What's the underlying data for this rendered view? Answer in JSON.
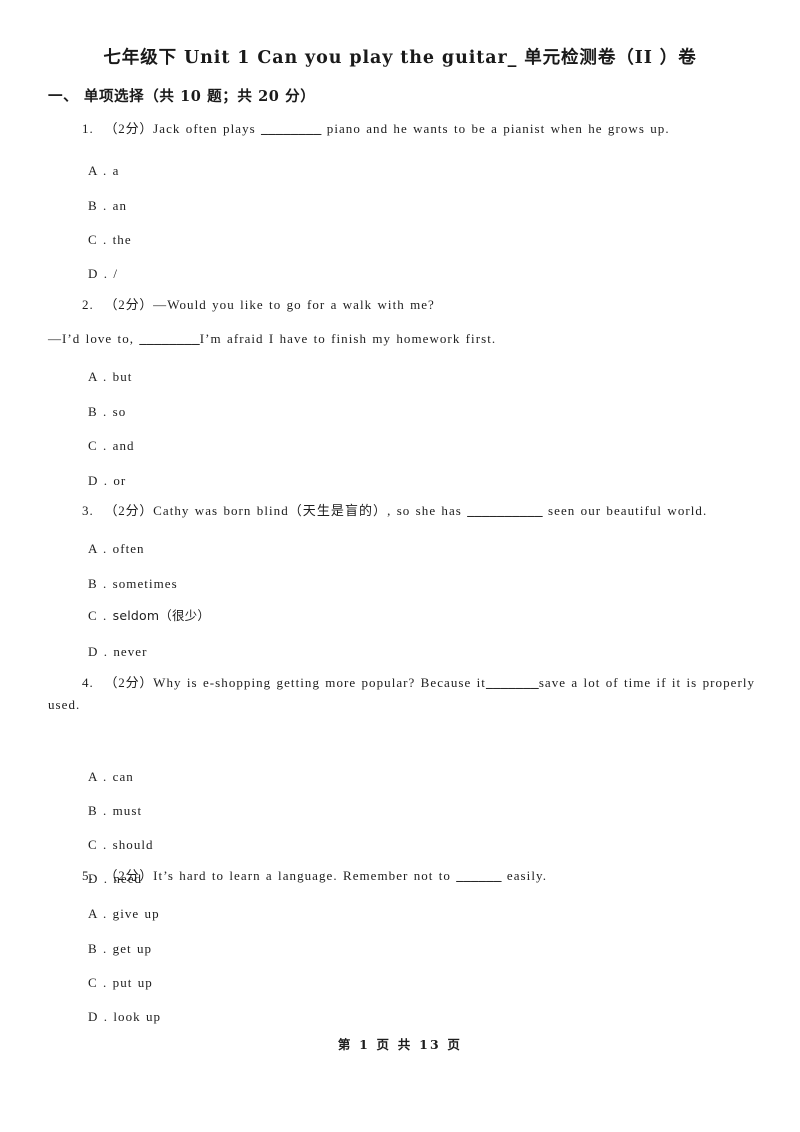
{
  "document": {
    "title": "七年级下 Unit 1 Can you play the guitar_ 单元检测卷（II ）卷",
    "section_heading": "一、 单项选择（共 10 题；共 20 分）",
    "footer": "第 1 页 共 13 页"
  },
  "questions": [
    {
      "number": "1.",
      "points": "（2分）",
      "stem_before": "Jack often plays",
      "blank": "________",
      "stem_after": "piano and he wants to be a pianist when he grows up.",
      "options": [
        {
          "letter": "A .",
          "text": "a"
        },
        {
          "letter": "B .",
          "text": "an"
        },
        {
          "letter": "C .",
          "text": "the"
        },
        {
          "letter": "D .",
          "text": "/"
        }
      ]
    },
    {
      "number": "2.",
      "points": "（2分）",
      "stem_before": "—Would you like to go for a walk with me?",
      "stem_line2_before": "—I’d love to,",
      "blank": "________",
      "stem_line2_after": "I’m afraid I have to finish my homework first.",
      "options": [
        {
          "letter": "A .",
          "text": "but"
        },
        {
          "letter": "B .",
          "text": "so"
        },
        {
          "letter": "C .",
          "text": "and"
        },
        {
          "letter": "D .",
          "text": "or"
        }
      ]
    },
    {
      "number": "3.",
      "points": "（2分）",
      "stem_before": "Cathy was born blind（天生是盲的）, so she has",
      "blank": "__________",
      "stem_after": "seen our beautiful world.",
      "options": [
        {
          "letter": "A .",
          "text": "often"
        },
        {
          "letter": "B .",
          "text": "sometimes"
        },
        {
          "letter": "C .",
          "text": "seldom（很少）"
        },
        {
          "letter": "D .",
          "text": "never"
        }
      ]
    },
    {
      "number": "4.",
      "points": "（2分）",
      "stem_before": "Why is e-shopping getting more popular? Because it",
      "blank": "_______",
      "stem_after": "save a lot of time if it is properly used.",
      "options": [
        {
          "letter": "A .",
          "text": "can"
        },
        {
          "letter": "B .",
          "text": "must"
        },
        {
          "letter": "C .",
          "text": "should"
        },
        {
          "letter": "D .",
          "text": "need"
        }
      ]
    },
    {
      "number": "5.",
      "points": "（2分）",
      "stem_before": "It’s hard to learn a language. Remember not to",
      "blank": "______",
      "stem_after": "easily.",
      "options": [
        {
          "letter": "A .",
          "text": "give up"
        },
        {
          "letter": "B .",
          "text": "get up"
        },
        {
          "letter": "C .",
          "text": "put up"
        },
        {
          "letter": "D .",
          "text": "look up"
        }
      ]
    }
  ]
}
